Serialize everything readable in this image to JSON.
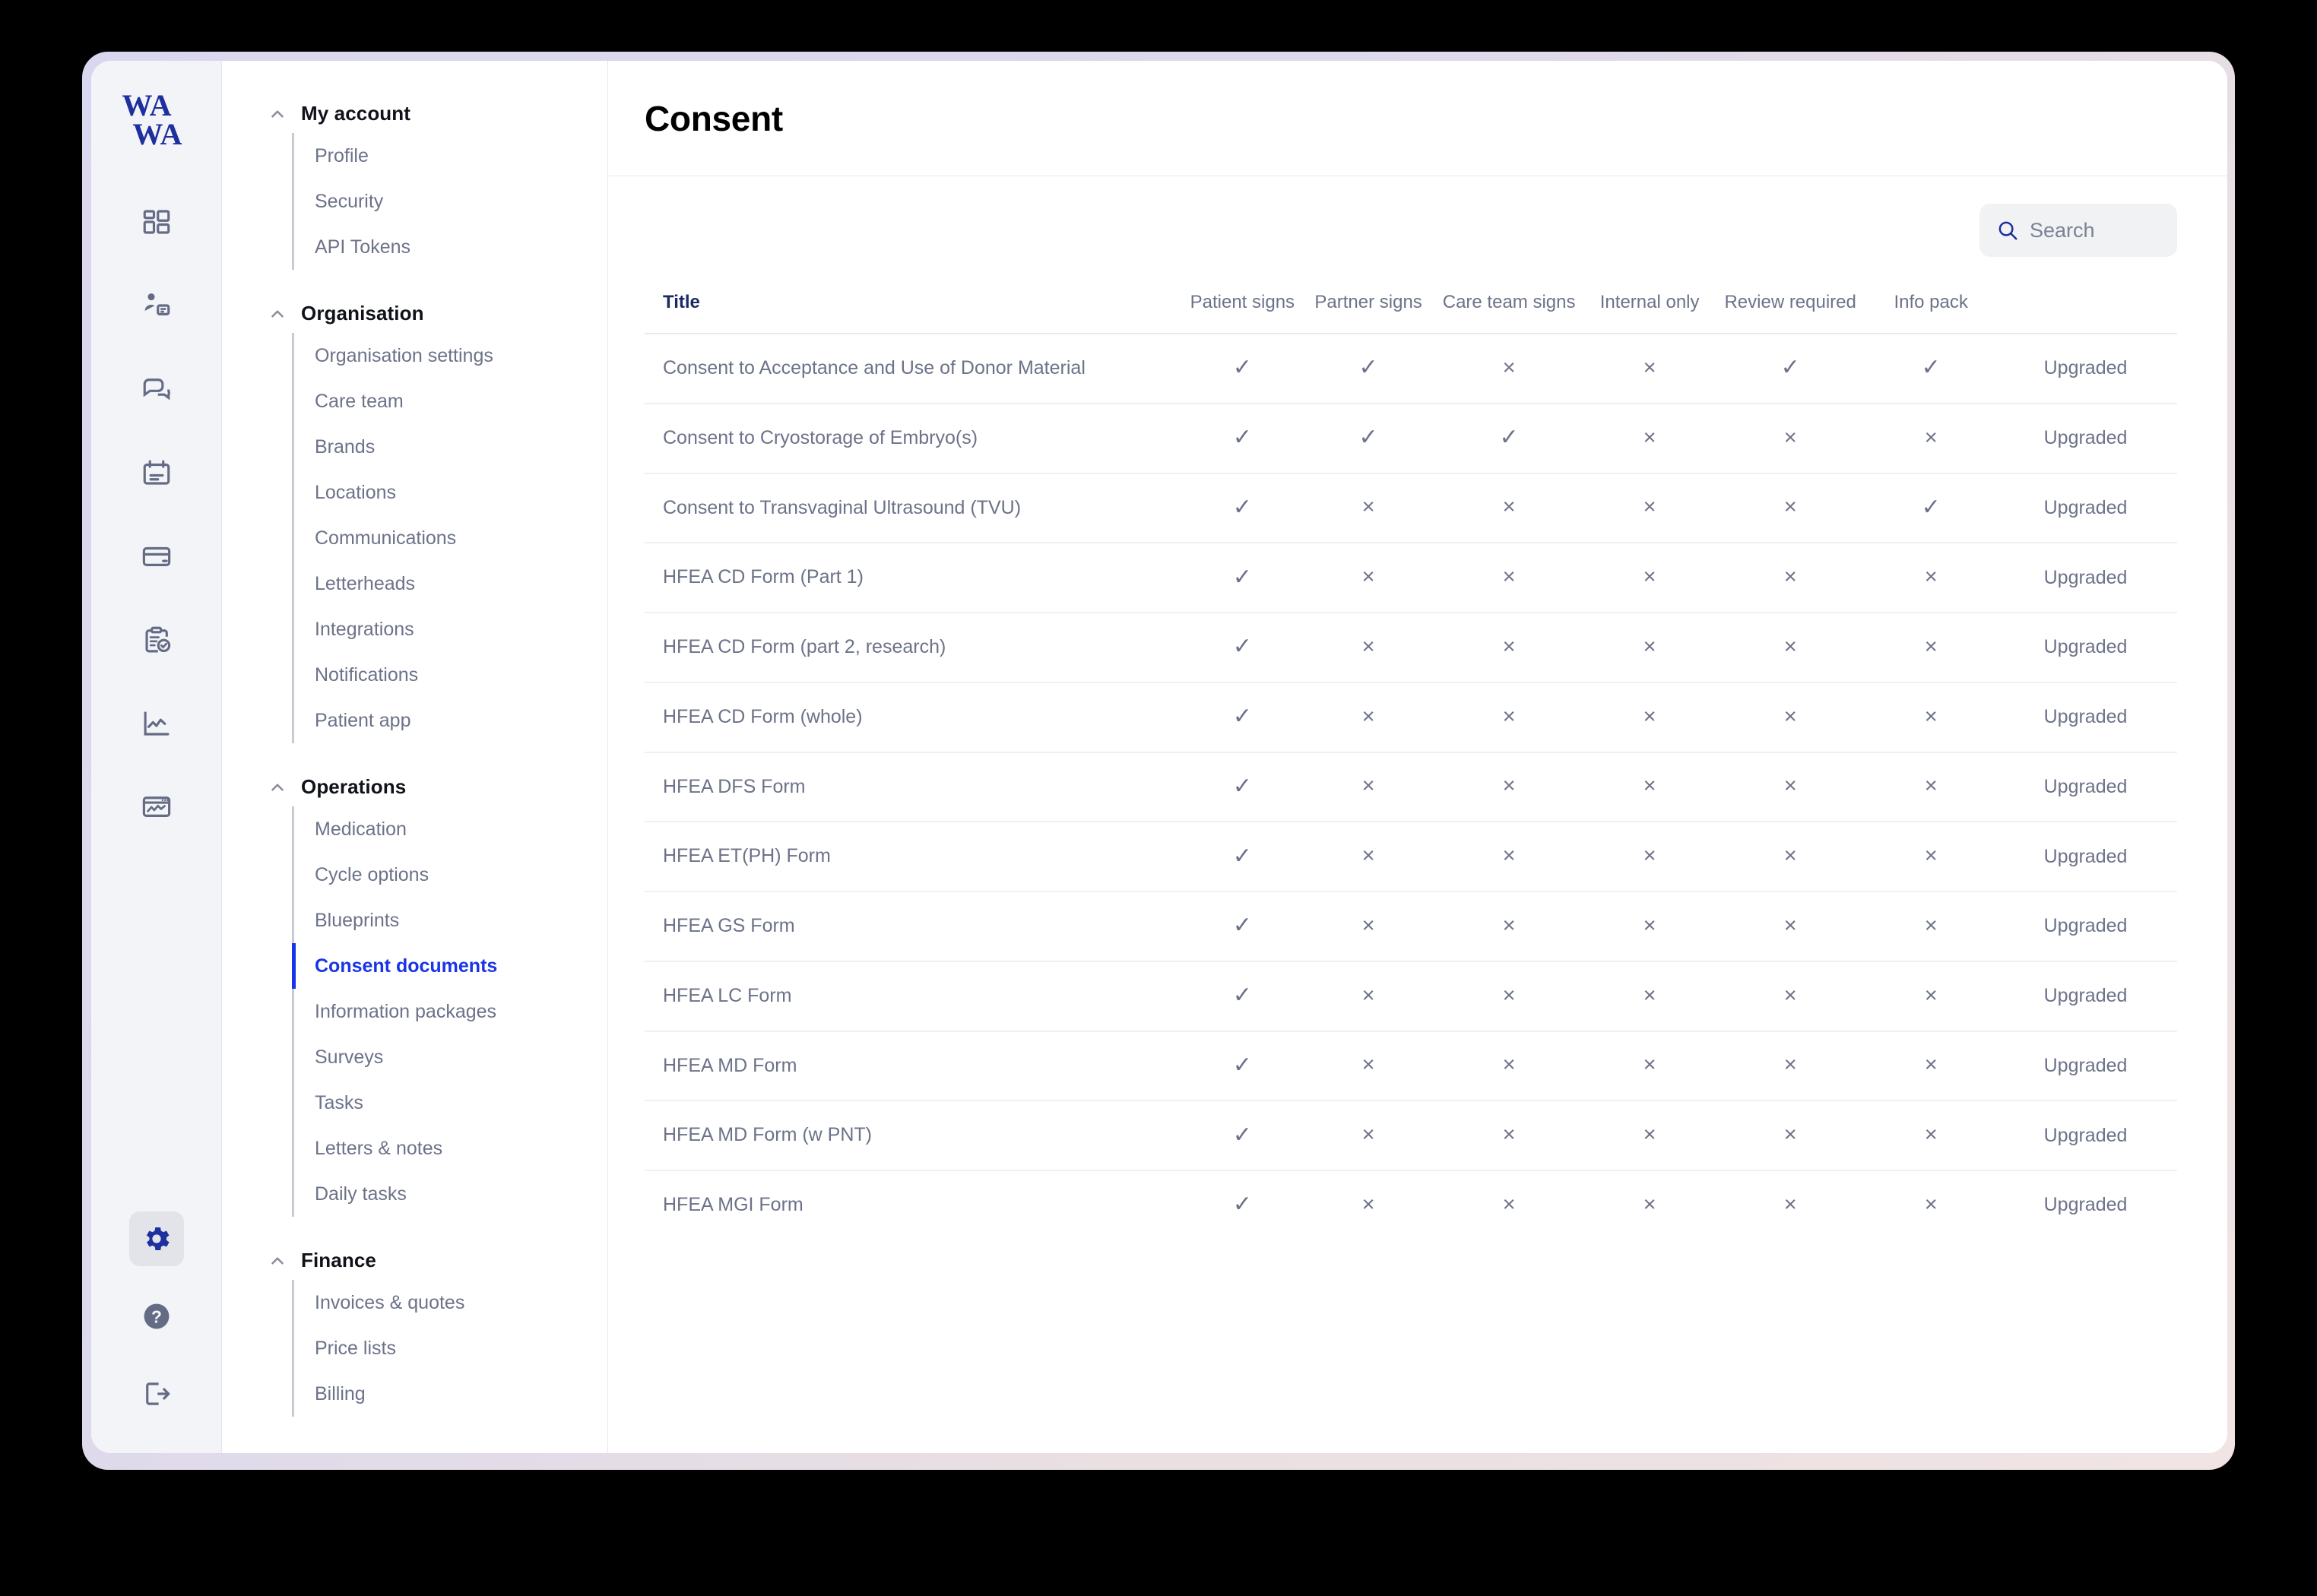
{
  "brand": {
    "line1": "WA",
    "line2": "WA"
  },
  "icon_rail": {
    "items": [
      {
        "icon": "dashboard-icon",
        "active": false
      },
      {
        "icon": "patient-record-icon",
        "active": false
      },
      {
        "icon": "messages-icon",
        "active": false
      },
      {
        "icon": "calendar-icon",
        "active": false
      },
      {
        "icon": "payments-card-icon",
        "active": false
      },
      {
        "icon": "clipboard-check-icon",
        "active": false
      },
      {
        "icon": "analytics-line-chart-icon",
        "active": false
      },
      {
        "icon": "monitoring-window-icon",
        "active": false
      }
    ],
    "bottom_items": [
      {
        "icon": "gear-icon",
        "active": true
      },
      {
        "icon": "help-question-icon",
        "active": false
      },
      {
        "icon": "logout-icon",
        "active": false
      }
    ]
  },
  "nav": {
    "groups": [
      {
        "title": "My account",
        "items": [
          {
            "label": "Profile",
            "active": false
          },
          {
            "label": "Security",
            "active": false
          },
          {
            "label": "API Tokens",
            "active": false
          }
        ]
      },
      {
        "title": "Organisation",
        "items": [
          {
            "label": "Organisation settings",
            "active": false
          },
          {
            "label": "Care team",
            "active": false
          },
          {
            "label": "Brands",
            "active": false
          },
          {
            "label": "Locations",
            "active": false
          },
          {
            "label": "Communications",
            "active": false
          },
          {
            "label": "Letterheads",
            "active": false
          },
          {
            "label": "Integrations",
            "active": false
          },
          {
            "label": "Notifications",
            "active": false
          },
          {
            "label": "Patient app",
            "active": false
          }
        ]
      },
      {
        "title": "Operations",
        "items": [
          {
            "label": "Medication",
            "active": false
          },
          {
            "label": "Cycle options",
            "active": false
          },
          {
            "label": "Blueprints",
            "active": false
          },
          {
            "label": "Consent documents",
            "active": true
          },
          {
            "label": "Information packages",
            "active": false
          },
          {
            "label": "Surveys",
            "active": false
          },
          {
            "label": "Tasks",
            "active": false
          },
          {
            "label": "Letters & notes",
            "active": false
          },
          {
            "label": "Daily tasks",
            "active": false
          }
        ]
      },
      {
        "title": "Finance",
        "items": [
          {
            "label": "Invoices & quotes",
            "active": false
          },
          {
            "label": "Price lists",
            "active": false
          },
          {
            "label": "Billing",
            "active": false
          }
        ]
      }
    ]
  },
  "header": {
    "title": "Consent"
  },
  "search": {
    "placeholder": "Search",
    "value": "",
    "icon": "search-icon"
  },
  "table": {
    "columns": [
      "Title",
      "Patient signs",
      "Partner signs",
      "Care team signs",
      "Internal only",
      "Review required",
      "Info pack",
      ""
    ],
    "marks": {
      "yes": "✓",
      "no": "×"
    },
    "rows": [
      {
        "title": "Consent to Acceptance and Use of Donor Material",
        "patient_signs": true,
        "partner_signs": true,
        "care_team_signs": false,
        "internal_only": false,
        "review_required": true,
        "info_pack": true,
        "status": "Upgraded"
      },
      {
        "title": "Consent to Cryostorage of Embryo(s)",
        "patient_signs": true,
        "partner_signs": true,
        "care_team_signs": true,
        "internal_only": false,
        "review_required": false,
        "info_pack": false,
        "status": "Upgraded"
      },
      {
        "title": "Consent to Transvaginal Ultrasound (TVU)",
        "patient_signs": true,
        "partner_signs": false,
        "care_team_signs": false,
        "internal_only": false,
        "review_required": false,
        "info_pack": true,
        "status": "Upgraded"
      },
      {
        "title": "HFEA CD Form (Part 1)",
        "patient_signs": true,
        "partner_signs": false,
        "care_team_signs": false,
        "internal_only": false,
        "review_required": false,
        "info_pack": false,
        "status": "Upgraded"
      },
      {
        "title": "HFEA CD Form (part 2, research)",
        "patient_signs": true,
        "partner_signs": false,
        "care_team_signs": false,
        "internal_only": false,
        "review_required": false,
        "info_pack": false,
        "status": "Upgraded"
      },
      {
        "title": "HFEA CD Form (whole)",
        "patient_signs": true,
        "partner_signs": false,
        "care_team_signs": false,
        "internal_only": false,
        "review_required": false,
        "info_pack": false,
        "status": "Upgraded"
      },
      {
        "title": "HFEA DFS Form",
        "patient_signs": true,
        "partner_signs": false,
        "care_team_signs": false,
        "internal_only": false,
        "review_required": false,
        "info_pack": false,
        "status": "Upgraded"
      },
      {
        "title": "HFEA ET(PH) Form",
        "patient_signs": true,
        "partner_signs": false,
        "care_team_signs": false,
        "internal_only": false,
        "review_required": false,
        "info_pack": false,
        "status": "Upgraded"
      },
      {
        "title": "HFEA GS Form",
        "patient_signs": true,
        "partner_signs": false,
        "care_team_signs": false,
        "internal_only": false,
        "review_required": false,
        "info_pack": false,
        "status": "Upgraded"
      },
      {
        "title": "HFEA LC Form",
        "patient_signs": true,
        "partner_signs": false,
        "care_team_signs": false,
        "internal_only": false,
        "review_required": false,
        "info_pack": false,
        "status": "Upgraded"
      },
      {
        "title": "HFEA MD Form",
        "patient_signs": true,
        "partner_signs": false,
        "care_team_signs": false,
        "internal_only": false,
        "review_required": false,
        "info_pack": false,
        "status": "Upgraded"
      },
      {
        "title": "HFEA MD Form (w PNT)",
        "patient_signs": true,
        "partner_signs": false,
        "care_team_signs": false,
        "internal_only": false,
        "review_required": false,
        "info_pack": false,
        "status": "Upgraded"
      },
      {
        "title": "HFEA MGI Form",
        "patient_signs": true,
        "partner_signs": false,
        "care_team_signs": false,
        "internal_only": false,
        "review_required": false,
        "info_pack": false,
        "status": "Upgraded"
      }
    ]
  },
  "colors": {
    "accent_blue": "#1a34e8",
    "brand_navy": "#1e2f9e",
    "text_muted": "#6c7288",
    "rail_bg": "#f3f4f7",
    "frame_start": "#d9d7ef",
    "frame_end": "#f0e4e4"
  }
}
